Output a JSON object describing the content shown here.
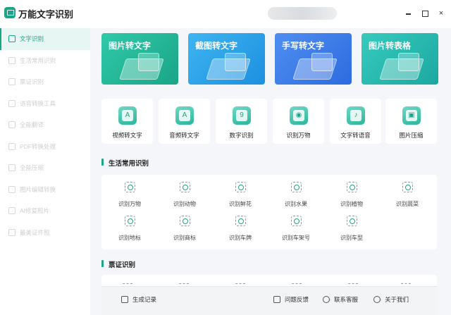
{
  "app": {
    "title": "万能文字识别"
  },
  "window": {
    "minimize": "—",
    "maximize": "□",
    "close": "×"
  },
  "sidebar": {
    "items": [
      {
        "label": "文字识别",
        "active": true
      },
      {
        "label": "生活常用识别"
      },
      {
        "label": "票证识别"
      },
      {
        "label": "语音转换工具"
      },
      {
        "label": "全能翻译"
      },
      {
        "label": "PDF转换处理"
      },
      {
        "label": "全能压缩"
      },
      {
        "label": "图片编辑转换"
      },
      {
        "label": "AI修复照片"
      },
      {
        "label": "最美证件照"
      }
    ]
  },
  "banners": [
    {
      "label": "图片转文字"
    },
    {
      "label": "截图转文字"
    },
    {
      "label": "手写转文字"
    },
    {
      "label": "图片转表格"
    }
  ],
  "tools": [
    {
      "label": "视频转文字",
      "glyph": "A"
    },
    {
      "label": "音频转文字",
      "glyph": "A"
    },
    {
      "label": "数字识别",
      "glyph": "9"
    },
    {
      "label": "识别万物",
      "glyph": "◉"
    },
    {
      "label": "文字转语音",
      "glyph": "♪"
    },
    {
      "label": "图片压缩",
      "glyph": "▣"
    }
  ],
  "sections": {
    "life": "生活常用识别",
    "ticket": "票证识别"
  },
  "life_items": [
    {
      "label": "识别万物"
    },
    {
      "label": "识别动物"
    },
    {
      "label": "识别鲜花"
    },
    {
      "label": "识别水果"
    },
    {
      "label": "识别植物"
    },
    {
      "label": "识别蔬菜"
    },
    {
      "label": "识别地标"
    },
    {
      "label": "识别商标"
    },
    {
      "label": "识别车牌"
    },
    {
      "label": "识别车架号"
    },
    {
      "label": "识别车型"
    }
  ],
  "footer": {
    "history": "生成记录",
    "feedback": "问题反馈",
    "support": "联系客服",
    "about": "关于我们"
  }
}
